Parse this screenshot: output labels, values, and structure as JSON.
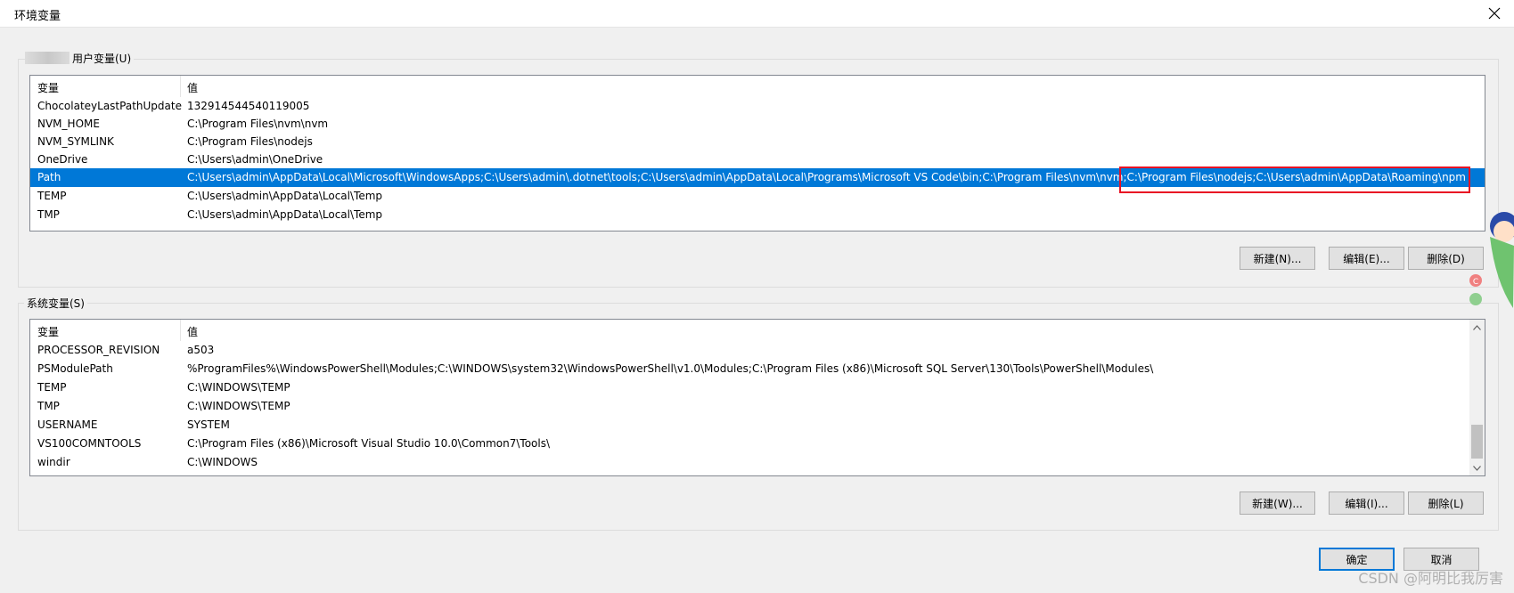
{
  "window": {
    "title": "环境变量"
  },
  "user_vars": {
    "group_label": "用户变量(U)",
    "columns": [
      "变量",
      "值"
    ],
    "rows": [
      {
        "name": "ChocolateyLastPathUpdate",
        "value": "132914544540119005"
      },
      {
        "name": "NVM_HOME",
        "value": "C:\\Program Files\\nvm\\nvm"
      },
      {
        "name": "NVM_SYMLINK",
        "value": "C:\\Program Files\\nodejs"
      },
      {
        "name": "OneDrive",
        "value": "C:\\Users\\admin\\OneDrive"
      },
      {
        "name": "Path",
        "value": "C:\\Users\\admin\\AppData\\Local\\Microsoft\\WindowsApps;C:\\Users\\admin\\.dotnet\\tools;C:\\Users\\admin\\AppData\\Local\\Programs\\Microsoft VS Code\\bin;C:\\Program Files\\nvm\\nvm;C:\\Program Files\\nodejs;C:\\Users\\admin\\AppData\\Roaming\\npm"
      },
      {
        "name": "TEMP",
        "value": "C:\\Users\\admin\\AppData\\Local\\Temp"
      },
      {
        "name": "TMP",
        "value": "C:\\Users\\admin\\AppData\\Local\\Temp"
      }
    ],
    "selected_row": "Path",
    "buttons": {
      "new": "新建(N)...",
      "edit": "编辑(E)...",
      "delete": "删除(D)"
    }
  },
  "system_vars": {
    "group_label": "系统变量(S)",
    "columns": [
      "变量",
      "值"
    ],
    "rows": [
      {
        "name": "PROCESSOR_REVISION",
        "value": "a503"
      },
      {
        "name": "PSModulePath",
        "value": "%ProgramFiles%\\WindowsPowerShell\\Modules;C:\\WINDOWS\\system32\\WindowsPowerShell\\v1.0\\Modules;C:\\Program Files (x86)\\Microsoft SQL Server\\130\\Tools\\PowerShell\\Modules\\"
      },
      {
        "name": "TEMP",
        "value": "C:\\WINDOWS\\TEMP"
      },
      {
        "name": "TMP",
        "value": "C:\\WINDOWS\\TEMP"
      },
      {
        "name": "USERNAME",
        "value": "SYSTEM"
      },
      {
        "name": "VS100COMNTOOLS",
        "value": "C:\\Program Files (x86)\\Microsoft Visual Studio 10.0\\Common7\\Tools\\"
      },
      {
        "name": "windir",
        "value": "C:\\WINDOWS"
      }
    ],
    "buttons": {
      "new": "新建(W)...",
      "edit": "编辑(I)...",
      "delete": "删除(L)"
    }
  },
  "footer": {
    "ok": "确定",
    "cancel": "取消"
  },
  "watermark": "CSDN @阿明比我厉害",
  "colors": {
    "selection": "#0078d7",
    "highlight_box": "#e81123"
  },
  "icons": [
    "close-icon",
    "scroll-up-icon",
    "scroll-down-icon"
  ]
}
